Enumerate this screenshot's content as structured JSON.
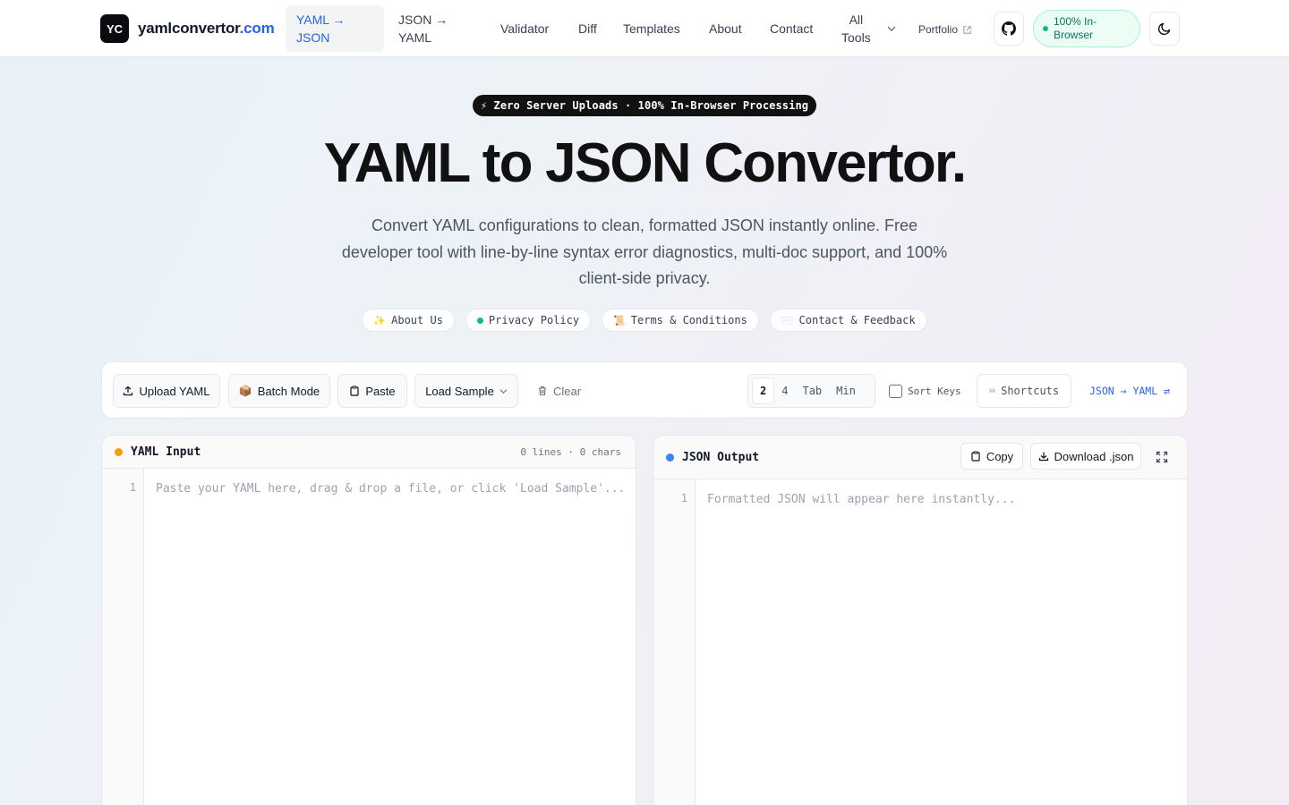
{
  "header": {
    "logo_mark": "YC",
    "logo_name": "yamlconvertor",
    "logo_tld": ".com",
    "nav": {
      "yaml_to_json_l1": "YAML →",
      "yaml_to_json_l2": "JSON",
      "json_to_yaml_l1": "JSON →",
      "json_to_yaml_l2": "YAML",
      "validator": "Validator",
      "diff": "Diff",
      "templates": "Templates",
      "about": "About",
      "contact": "Contact",
      "all_tools_l1": "All",
      "all_tools_l2": "Tools",
      "portfolio": "Portfolio"
    },
    "status_l1": "100% In-",
    "status_l2": "Browser"
  },
  "hero": {
    "badge": "⚡ Zero Server Uploads · 100% In-Browser Processing",
    "title": "YAML to JSON Convertor.",
    "subtitle": "Convert YAML configurations to clean, formatted JSON instantly online. Free developer tool with line-by-line syntax error diagnostics, multi-doc support, and 100% client-side privacy.",
    "chips": {
      "about": "About Us",
      "privacy": "Privacy Policy",
      "terms": "Terms & Conditions",
      "contact": "Contact & Feedback"
    }
  },
  "toolbar": {
    "upload": "Upload YAML",
    "batch": "Batch Mode",
    "paste": "Paste",
    "load_sample": "Load Sample",
    "clear": "Clear",
    "indent_options": [
      "2",
      "4",
      "Tab",
      "Min"
    ],
    "indent_selected": "2",
    "sort_keys": "Sort Keys",
    "shortcuts": "Shortcuts",
    "swap": "JSON → YAML ⇄"
  },
  "input_panel": {
    "title": "YAML Input",
    "stats": "0 lines · 0 chars",
    "line_number": "1",
    "placeholder": "Paste your YAML here, drag & drop a file, or click 'Load Sample'..."
  },
  "output_panel": {
    "title": "JSON Output",
    "copy": "Copy",
    "download": "Download .json",
    "line_number": "1",
    "placeholder": "Formatted JSON will appear here instantly..."
  },
  "colors": {
    "accent": "#2563eb",
    "input_dot": "#f59e0b",
    "output_dot": "#3b82f6",
    "status_green": "#10b981"
  }
}
